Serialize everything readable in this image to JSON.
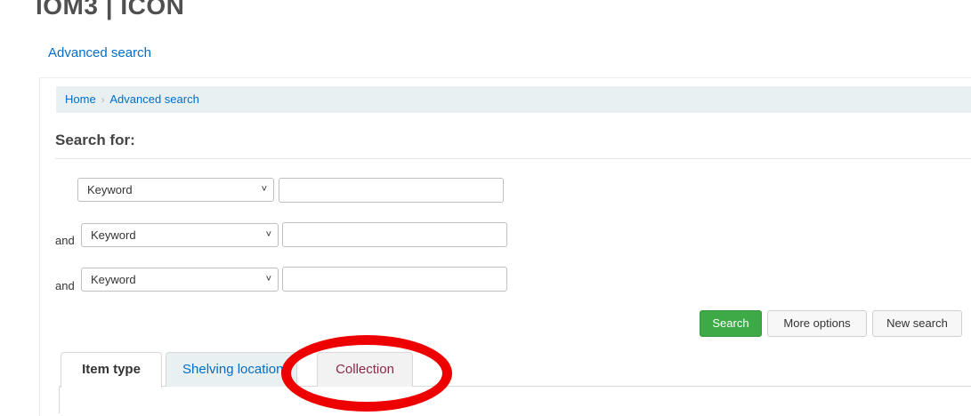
{
  "header": {
    "site_title": "IOM3 | ICON"
  },
  "nav": {
    "advanced_search_link": "Advanced search"
  },
  "breadcrumb": {
    "home": "Home",
    "separator": "›",
    "current": "Advanced search"
  },
  "search": {
    "heading": "Search for:",
    "rows": [
      {
        "operator": "",
        "field": "Keyword",
        "value": ""
      },
      {
        "operator": "and",
        "field": "Keyword",
        "value": ""
      },
      {
        "operator": "and",
        "field": "Keyword",
        "value": ""
      }
    ]
  },
  "buttons": {
    "search": "Search",
    "more_options": "More options",
    "new_search": "New search"
  },
  "tabs": [
    {
      "label": "Item type",
      "active": true
    },
    {
      "label": "Shelving location",
      "active": false
    },
    {
      "label": "Collection",
      "active": false,
      "highlighted": true
    }
  ],
  "colors": {
    "link": "#006ec9",
    "primary_button": "#3daa47",
    "breadcrumb_bg": "#e9f0f1",
    "highlight": "#ee0000"
  }
}
